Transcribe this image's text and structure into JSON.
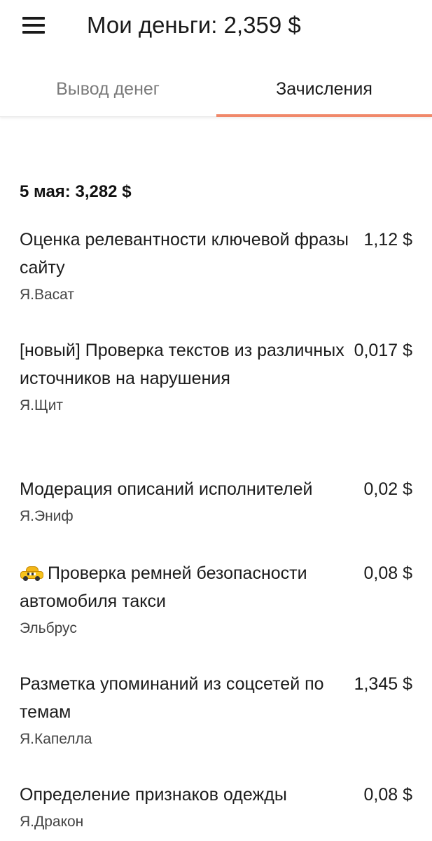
{
  "header": {
    "title": "Мои деньги: 2,359 $"
  },
  "tabs": [
    {
      "label": "Вывод денег",
      "active": false
    },
    {
      "label": "Зачисления",
      "active": true
    }
  ],
  "colors": {
    "tab_indicator": "#f0886a"
  },
  "day": {
    "heading": "5 мая: 3,282 $"
  },
  "entries": [
    {
      "title": "Оценка релевантности ключевой фразы сайту",
      "amount": "1,12 $",
      "source": "Я.Васат"
    },
    {
      "title": "[новый] Проверка текстов из различных источников на нарушения",
      "amount": "0,017 $",
      "source": "Я.Щит"
    },
    {
      "title": "Модерация описаний исполнителей",
      "amount": "0,02 $",
      "source": "Я.Эниф"
    },
    {
      "icon": "taxi-icon",
      "title": "Проверка ремней безопасности автомобиля такси",
      "amount": "0,08 $",
      "source": "Эльбрус"
    },
    {
      "title": "Разметка упоминаний из соцсетей по темам",
      "amount": "1,345 $",
      "source": "Я.Капелла"
    },
    {
      "title": "Определение признаков одежды",
      "amount": "0,08 $",
      "source": "Я.Дракон"
    }
  ]
}
